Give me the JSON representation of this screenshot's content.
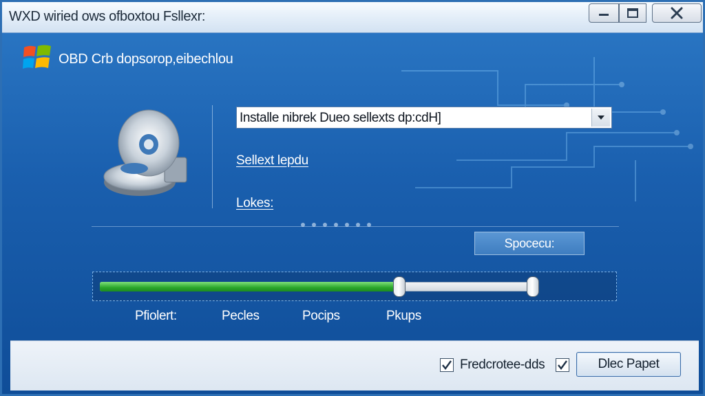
{
  "window": {
    "title": "WXD wiried ows ofboxtou Fsllexr:",
    "buttons": {
      "minimize": "minimize-icon",
      "maximize": "maximize-icon",
      "close": "close-icon"
    }
  },
  "header": {
    "text": "OBD Crb dopsorop,eibechlou",
    "logo": "windows-logo"
  },
  "combo": {
    "value": "Installe nibrek Dueo sellexts dp:cdH]",
    "icon": "dropdown-arrow-icon"
  },
  "links": {
    "select": "Sellext lepdu",
    "lokes": "Lokes:"
  },
  "spacer_button": "Spocecu:",
  "slider": {
    "progress_fraction": 0.69,
    "secondary_fraction": 0.998,
    "labels": [
      "Pfiolert:",
      "Pecles",
      "Pocips",
      "Pkups"
    ]
  },
  "footer": {
    "checkbox1": {
      "checked": true
    },
    "checkbox1_label": "Fredcrotee-dds",
    "checkbox2": {
      "checked": true
    },
    "ok_button": "Dlec Papet"
  },
  "colors": {
    "accent": "#1a5fae",
    "progress": "#2aa62a",
    "footer": "#e4ecf5"
  }
}
